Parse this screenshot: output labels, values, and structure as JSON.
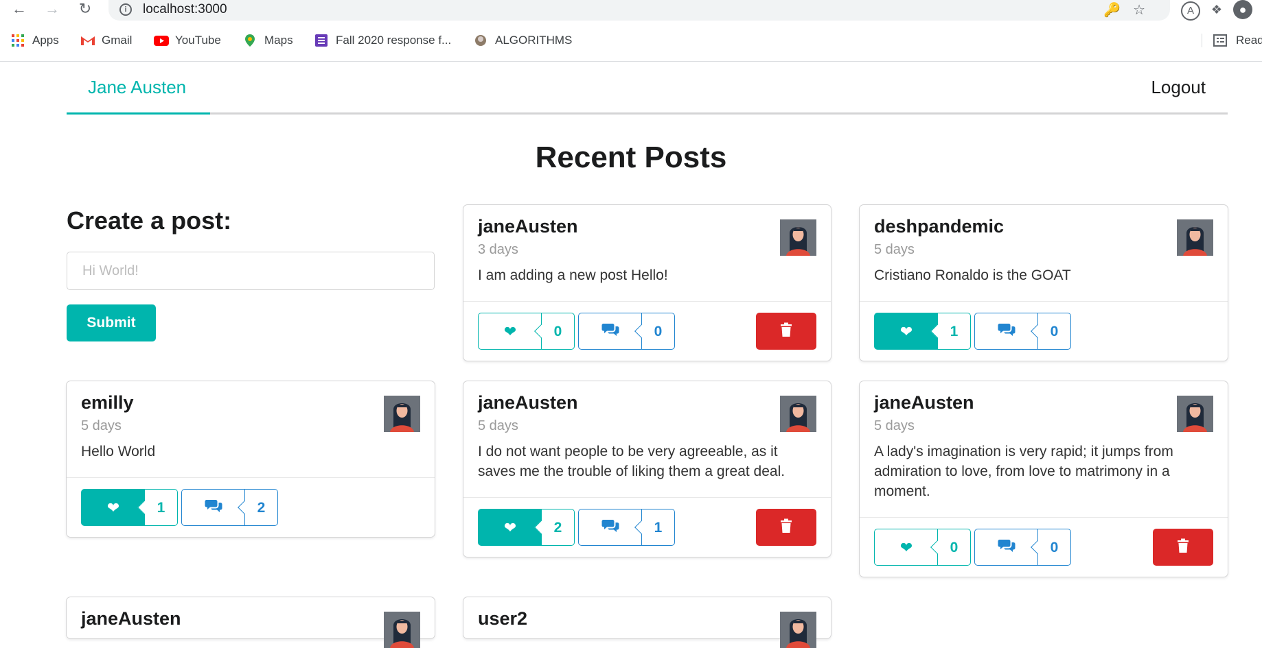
{
  "browser": {
    "url": "localhost:3000",
    "bookmarks": [
      "Apps",
      "Gmail",
      "YouTube",
      "Maps",
      "Fall 2020 response f...",
      "ALGORITHMS"
    ],
    "reading_list_label": "Read"
  },
  "nav": {
    "user_name": "Jane Austen",
    "logout_label": "Logout"
  },
  "page_title": "Recent Posts",
  "create_post": {
    "title": "Create a post:",
    "placeholder": "Hi World!",
    "submit_label": "Submit"
  },
  "colors": {
    "accent": "#00b5ad",
    "comment": "#2185d0",
    "delete": "#db2828"
  },
  "posts": [
    {
      "user": "janeAusten",
      "time": "3 days",
      "body": "I am adding a new post Hello!",
      "likes": "0",
      "comments": "0",
      "liked": false,
      "deletable": true
    },
    {
      "user": "deshpandemic",
      "time": "5 days",
      "body": "Cristiano Ronaldo is the GOAT",
      "likes": "1",
      "comments": "0",
      "liked": true,
      "deletable": false
    },
    {
      "user": "emilly",
      "time": "5 days",
      "body": "Hello World",
      "likes": "1",
      "comments": "2",
      "liked": true,
      "deletable": false
    },
    {
      "user": "janeAusten",
      "time": "5 days",
      "body": "I do not want people to be very agreeable, as it saves me the trouble of liking them a great deal.",
      "likes": "2",
      "comments": "1",
      "liked": true,
      "deletable": true
    },
    {
      "user": "janeAusten",
      "time": "5 days",
      "body": "A lady's imagination is very rapid; it jumps from admiration to love, from love to matrimony in a moment.",
      "likes": "0",
      "comments": "0",
      "liked": false,
      "deletable": true
    },
    {
      "user": "janeAusten"
    },
    {
      "user": "user2"
    }
  ]
}
